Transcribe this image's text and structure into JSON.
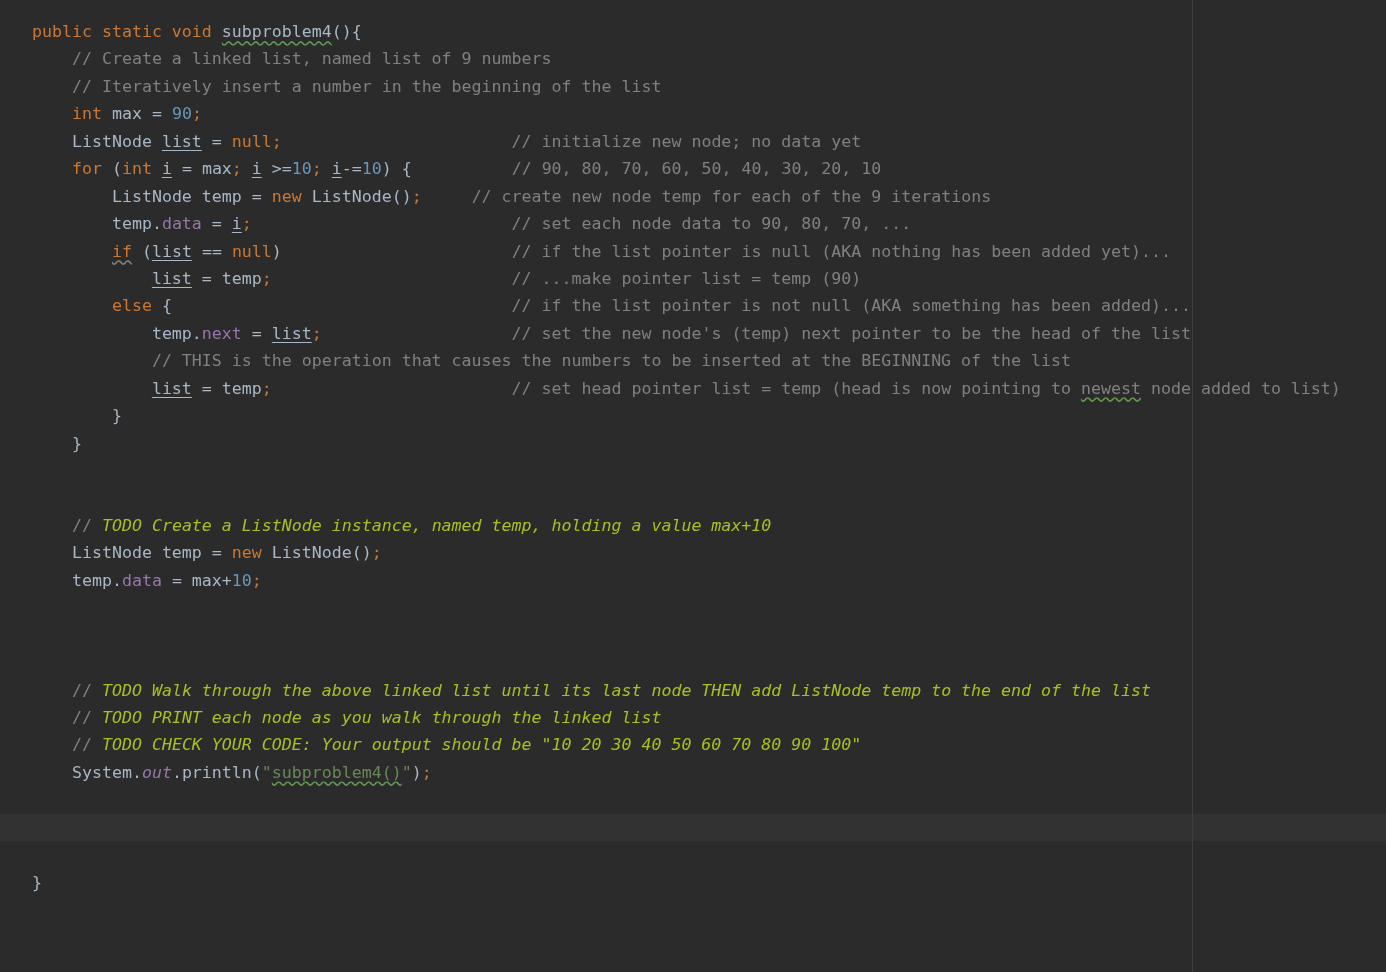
{
  "editor": {
    "lines": [
      {
        "kind": "code",
        "tokens": [
          {
            "kind": "keyword",
            "text": "public static void "
          },
          {
            "kind": "plain-typo",
            "text": "subproblem4"
          },
          {
            "kind": "plain",
            "text": "(){"
          }
        ]
      },
      {
        "kind": "code",
        "tokens": [
          {
            "kind": "comment",
            "text": "    // Create a linked list, named list of 9 numbers"
          }
        ]
      },
      {
        "kind": "code",
        "tokens": [
          {
            "kind": "comment",
            "text": "    // Iteratively insert a number in the beginning of the list"
          }
        ]
      },
      {
        "kind": "code",
        "tokens": [
          {
            "kind": "keyword",
            "text": "    int "
          },
          {
            "kind": "plain",
            "text": "max = "
          },
          {
            "kind": "number",
            "text": "90"
          },
          {
            "kind": "keyword",
            "text": ";"
          }
        ]
      },
      {
        "kind": "code",
        "tokens": [
          {
            "kind": "plain",
            "text": "    ListNode "
          },
          {
            "kind": "plain-reassigned",
            "text": "list"
          },
          {
            "kind": "plain",
            "text": " = "
          },
          {
            "kind": "keyword",
            "text": "null;"
          },
          {
            "kind": "comment",
            "text": "                       // initialize new node; no data yet"
          }
        ]
      },
      {
        "kind": "code",
        "tokens": [
          {
            "kind": "keyword",
            "text": "    for "
          },
          {
            "kind": "plain",
            "text": "("
          },
          {
            "kind": "keyword",
            "text": "int "
          },
          {
            "kind": "plain-reassigned",
            "text": "i"
          },
          {
            "kind": "plain",
            "text": " = max"
          },
          {
            "kind": "keyword",
            "text": "; "
          },
          {
            "kind": "plain-reassigned",
            "text": "i"
          },
          {
            "kind": "plain",
            "text": " >="
          },
          {
            "kind": "number",
            "text": "10"
          },
          {
            "kind": "keyword",
            "text": "; "
          },
          {
            "kind": "plain-reassigned",
            "text": "i"
          },
          {
            "kind": "plain",
            "text": "-="
          },
          {
            "kind": "number",
            "text": "10"
          },
          {
            "kind": "plain",
            "text": ") {"
          },
          {
            "kind": "comment",
            "text": "          // 90, 80, 70, 60, 50, 40, 30, 20, 10"
          }
        ]
      },
      {
        "kind": "code",
        "tokens": [
          {
            "kind": "plain",
            "text": "        ListNode temp = "
          },
          {
            "kind": "keyword",
            "text": "new "
          },
          {
            "kind": "plain",
            "text": "ListNode()"
          },
          {
            "kind": "keyword",
            "text": ";"
          },
          {
            "kind": "comment",
            "text": "     // create new node temp for each of the 9 iterations"
          }
        ]
      },
      {
        "kind": "code",
        "tokens": [
          {
            "kind": "plain",
            "text": "        temp."
          },
          {
            "kind": "field",
            "text": "data"
          },
          {
            "kind": "plain",
            "text": " = "
          },
          {
            "kind": "plain-reassigned",
            "text": "i"
          },
          {
            "kind": "keyword",
            "text": ";"
          },
          {
            "kind": "comment",
            "text": "                          // set each node data to 90, 80, 70, ..."
          }
        ]
      },
      {
        "kind": "code",
        "tokens": [
          {
            "kind": "keyword-warning",
            "text": "        if"
          },
          {
            "kind": "plain",
            "text": " ("
          },
          {
            "kind": "plain-reassigned",
            "text": "list"
          },
          {
            "kind": "plain",
            "text": " == "
          },
          {
            "kind": "keyword",
            "text": "null"
          },
          {
            "kind": "plain",
            "text": ")"
          },
          {
            "kind": "comment",
            "text": "                       // if the list pointer is null (AKA nothing has been added yet)..."
          }
        ]
      },
      {
        "kind": "code",
        "tokens": [
          {
            "kind": "plain-reassigned",
            "text": "            list"
          },
          {
            "kind": "plain",
            "text": " = temp"
          },
          {
            "kind": "keyword",
            "text": ";"
          },
          {
            "kind": "comment",
            "text": "                        // ...make pointer list = temp (90)"
          }
        ]
      },
      {
        "kind": "code",
        "tokens": [
          {
            "kind": "keyword",
            "text": "        else "
          },
          {
            "kind": "plain",
            "text": "{"
          },
          {
            "kind": "comment",
            "text": "                                  // if the list pointer is not null (AKA something has been added)..."
          }
        ]
      },
      {
        "kind": "code",
        "tokens": [
          {
            "kind": "plain",
            "text": "            temp."
          },
          {
            "kind": "field",
            "text": "next"
          },
          {
            "kind": "plain",
            "text": " = "
          },
          {
            "kind": "plain-reassigned",
            "text": "list"
          },
          {
            "kind": "keyword",
            "text": ";"
          },
          {
            "kind": "comment",
            "text": "                   // set the new node's (temp) next pointer to be the head of the list"
          }
        ]
      },
      {
        "kind": "code",
        "tokens": [
          {
            "kind": "comment",
            "text": "            // THIS is the operation that causes the numbers to be inserted at the BEGINNING of the list"
          }
        ]
      },
      {
        "kind": "code",
        "tokens": [
          {
            "kind": "plain-reassigned",
            "text": "            list"
          },
          {
            "kind": "plain",
            "text": " = temp"
          },
          {
            "kind": "keyword",
            "text": ";"
          },
          {
            "kind": "comment",
            "text": "                        // set head pointer list = temp (head is now pointing to "
          },
          {
            "kind": "comment-typo",
            "text": "newest"
          },
          {
            "kind": "comment",
            "text": " node added to list)"
          }
        ]
      },
      {
        "kind": "code",
        "tokens": [
          {
            "kind": "plain",
            "text": "        }"
          }
        ]
      },
      {
        "kind": "code",
        "tokens": [
          {
            "kind": "plain",
            "text": "    }"
          }
        ]
      },
      {
        "kind": "blank"
      },
      {
        "kind": "blank"
      },
      {
        "kind": "code",
        "tokens": [
          {
            "kind": "comment",
            "text": "    // "
          },
          {
            "kind": "todo",
            "text": "TODO Create a ListNode instance, named temp, holding a value max+10"
          }
        ]
      },
      {
        "kind": "code",
        "tokens": [
          {
            "kind": "plain",
            "text": "    ListNode temp = "
          },
          {
            "kind": "keyword",
            "text": "new "
          },
          {
            "kind": "plain",
            "text": "ListNode()"
          },
          {
            "kind": "keyword",
            "text": ";"
          }
        ]
      },
      {
        "kind": "code",
        "tokens": [
          {
            "kind": "plain",
            "text": "    temp."
          },
          {
            "kind": "field",
            "text": "data"
          },
          {
            "kind": "plain",
            "text": " = max+"
          },
          {
            "kind": "number",
            "text": "10"
          },
          {
            "kind": "keyword",
            "text": ";"
          }
        ]
      },
      {
        "kind": "blank"
      },
      {
        "kind": "blank"
      },
      {
        "kind": "blank"
      },
      {
        "kind": "code",
        "tokens": [
          {
            "kind": "comment",
            "text": "    // "
          },
          {
            "kind": "todo",
            "text": "TODO Walk through the above linked list until its last node THEN add ListNode temp to the end of the list"
          }
        ]
      },
      {
        "kind": "code",
        "tokens": [
          {
            "kind": "comment",
            "text": "    // "
          },
          {
            "kind": "todo",
            "text": "TODO PRINT each node as you walk through the linked list"
          }
        ]
      },
      {
        "kind": "code",
        "tokens": [
          {
            "kind": "comment",
            "text": "    // "
          },
          {
            "kind": "todo",
            "text": "TODO CHECK YOUR CODE: Your output should be \"10 20 30 40 50 60 70 80 90 100\""
          }
        ]
      },
      {
        "kind": "code",
        "tokens": [
          {
            "kind": "plain",
            "text": "    System."
          },
          {
            "kind": "static-field",
            "text": "out"
          },
          {
            "kind": "plain",
            "text": ".println("
          },
          {
            "kind": "string",
            "text": "\""
          },
          {
            "kind": "string-typo",
            "text": "subproblem4()"
          },
          {
            "kind": "string",
            "text": "\""
          },
          {
            "kind": "plain",
            "text": ")"
          },
          {
            "kind": "keyword",
            "text": ";"
          }
        ]
      },
      {
        "kind": "blank"
      },
      {
        "kind": "caret"
      },
      {
        "kind": "blank"
      },
      {
        "kind": "code",
        "tokens": [
          {
            "kind": "plain",
            "text": "}"
          }
        ]
      }
    ]
  }
}
